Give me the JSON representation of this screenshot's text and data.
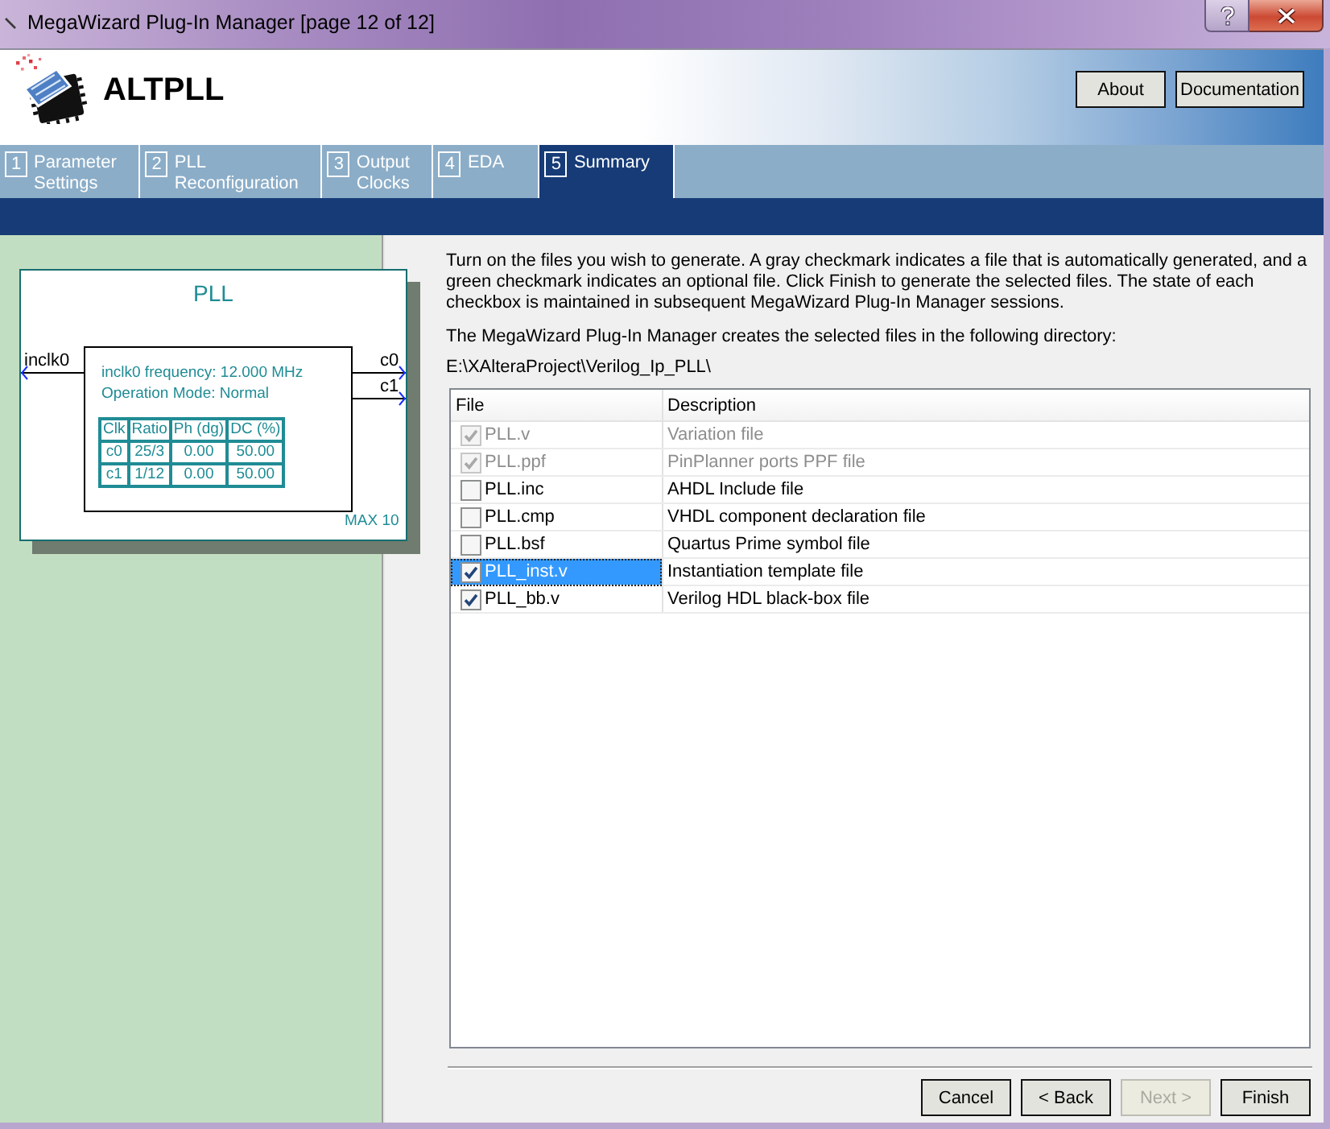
{
  "window": {
    "title": "MegaWizard Plug-In Manager [page 12 of 12]"
  },
  "header": {
    "title": "ALTPLL",
    "buttons": [
      {
        "label": "About"
      },
      {
        "label": "Documentation"
      }
    ]
  },
  "tabs": [
    {
      "number": "1",
      "label": "Parameter Settings",
      "selected": false
    },
    {
      "number": "2",
      "label": "PLL Reconfiguration",
      "selected": false
    },
    {
      "number": "3",
      "label": "Output Clocks",
      "selected": false
    },
    {
      "number": "4",
      "label": "EDA",
      "selected": false
    },
    {
      "number": "5",
      "label": "Summary",
      "selected": true
    }
  ],
  "diagram": {
    "title": "PLL",
    "input": "inclk0",
    "outputs": [
      "c0",
      "c1"
    ],
    "info": [
      "inclk0 frequency: 12.000 MHz",
      "Operation Mode: Normal"
    ],
    "table": {
      "columns": [
        "Clk",
        "Ratio",
        "Ph (dg)",
        "DC (%)"
      ],
      "rows": [
        [
          "c0",
          "25/3",
          "0.00",
          "50.00"
        ],
        [
          "c1",
          "1/12",
          "0.00",
          "50.00"
        ]
      ]
    },
    "device": "MAX 10"
  },
  "summary": {
    "instructions": "Turn on the files you wish to generate. A gray checkmark indicates a file that is automatically generated, and a green checkmark indicates an optional file. Click Finish to generate the selected files. The state of each checkbox is maintained in subsequent MegaWizard Plug-In Manager sessions.",
    "directory_label": "The MegaWizard Plug-In Manager creates the selected files in the following directory:",
    "directory": "E:\\XAlteraProject\\Verilog_Ip_PLL\\"
  },
  "files": {
    "columns": [
      "File",
      "Description"
    ],
    "rows": [
      {
        "file": "PLL.v",
        "description": "Variation file",
        "checked": true,
        "disabled": true,
        "selected": false
      },
      {
        "file": "PLL.ppf",
        "description": "PinPlanner ports PPF file",
        "checked": true,
        "disabled": true,
        "selected": false
      },
      {
        "file": "PLL.inc",
        "description": "AHDL Include file",
        "checked": false,
        "disabled": false,
        "selected": false
      },
      {
        "file": "PLL.cmp",
        "description": "VHDL component declaration file",
        "checked": false,
        "disabled": false,
        "selected": false
      },
      {
        "file": "PLL.bsf",
        "description": "Quartus Prime symbol file",
        "checked": false,
        "disabled": false,
        "selected": false
      },
      {
        "file": "PLL_inst.v",
        "description": "Instantiation template file",
        "checked": true,
        "disabled": false,
        "selected": true
      },
      {
        "file": "PLL_bb.v",
        "description": "Verilog HDL black-box file",
        "checked": true,
        "disabled": false,
        "selected": false
      }
    ]
  },
  "buttons": [
    {
      "label": "Cancel",
      "disabled": false
    },
    {
      "label": "< Back",
      "disabled": false
    },
    {
      "label": "Next >",
      "disabled": true
    },
    {
      "label": "Finish",
      "disabled": false
    }
  ]
}
